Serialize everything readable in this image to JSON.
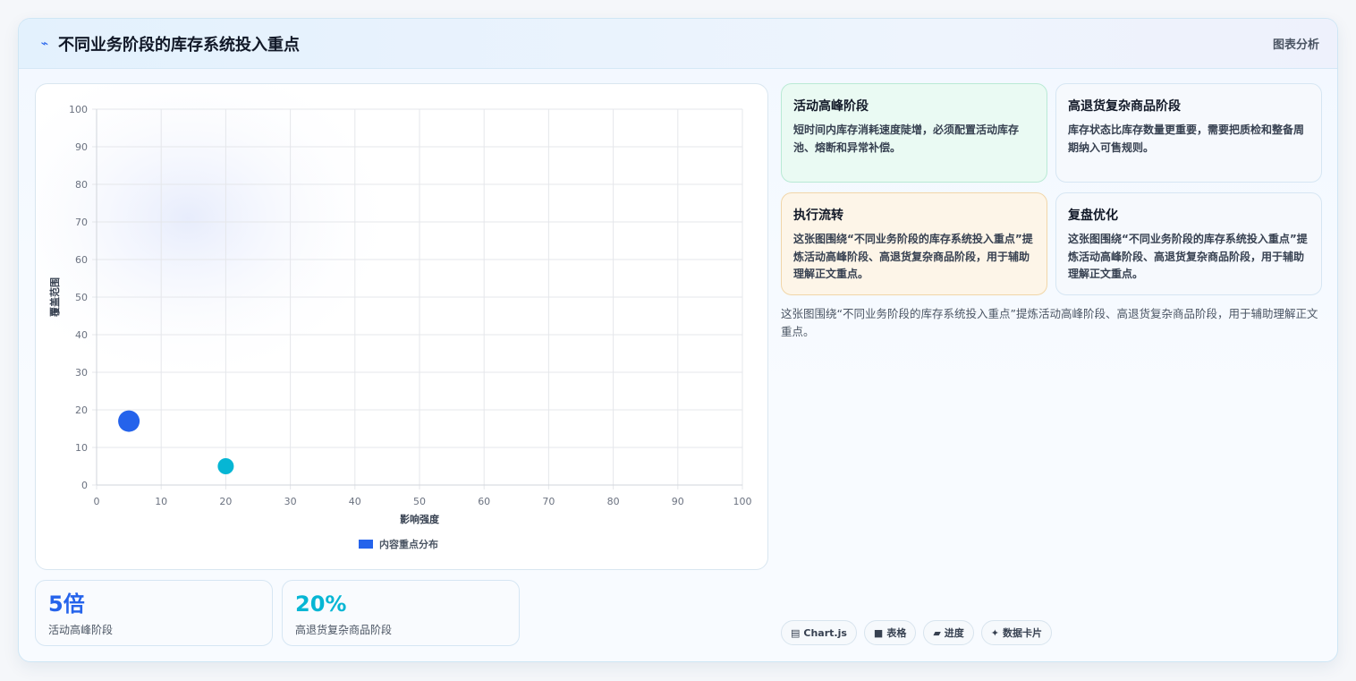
{
  "header": {
    "icon": "bolt-icon",
    "title": "不同业务阶段的库存系统投入重点",
    "tag": "图表分析"
  },
  "chart_data": {
    "type": "scatter",
    "title": "",
    "xlabel": "影响强度",
    "ylabel": "覆盖范围",
    "xlim": [
      0,
      100
    ],
    "ylim": [
      0,
      100
    ],
    "xticks": [
      "0",
      "10",
      "20",
      "30",
      "40",
      "50",
      "60",
      "70",
      "80",
      "90",
      "100"
    ],
    "yticks": [
      "0",
      "10",
      "20",
      "30",
      "40",
      "50",
      "60",
      "70",
      "80",
      "90",
      "100"
    ],
    "grid": true,
    "legend_position": "bottom",
    "series": [
      {
        "name": "内容重点分布",
        "color": "#2563eb",
        "points": [
          {
            "x": 5,
            "y": 17,
            "r": 12,
            "color": "#2563eb"
          },
          {
            "x": 20,
            "y": 5,
            "r": 9,
            "color": "#06b6d4"
          }
        ]
      }
    ]
  },
  "stats": [
    {
      "value": "5倍",
      "label": "活动高峰阶段",
      "color": "#2563eb"
    },
    {
      "value": "20%",
      "label": "高退货复杂商品阶段",
      "color": "#06b6d4"
    }
  ],
  "cards": [
    {
      "title": "活动高峰阶段",
      "text": "短时间内库存消耗速度陡增，必须配置活动库存池、熔断和异常补偿。"
    },
    {
      "title": "高退货复杂商品阶段",
      "text": "库存状态比库存数量更重要，需要把质检和整备周期纳入可售规则。"
    },
    {
      "title": "执行流转",
      "text": "这张图围绕“不同业务阶段的库存系统投入重点”提炼活动高峰阶段、高退货复杂商品阶段，用于辅助理解正文重点。"
    },
    {
      "title": "复盘优化",
      "text": "这张图围绕“不同业务阶段的库存系统投入重点”提炼活动高峰阶段、高退货复杂商品阶段，用于辅助理解正文重点。"
    }
  ],
  "summary": "这张图围绕“不同业务阶段的库存系统投入重点”提炼活动高峰阶段、高退货复杂商品阶段，用于辅助理解正文重点。",
  "chips": [
    {
      "icon": "chart-icon",
      "glyph": "▤",
      "label": "Chart.js"
    },
    {
      "icon": "table-icon",
      "glyph": "■",
      "label": "表格"
    },
    {
      "icon": "progress-icon",
      "glyph": "▰",
      "label": "进度"
    },
    {
      "icon": "sparkle-icon",
      "glyph": "✦",
      "label": "数据卡片"
    }
  ]
}
